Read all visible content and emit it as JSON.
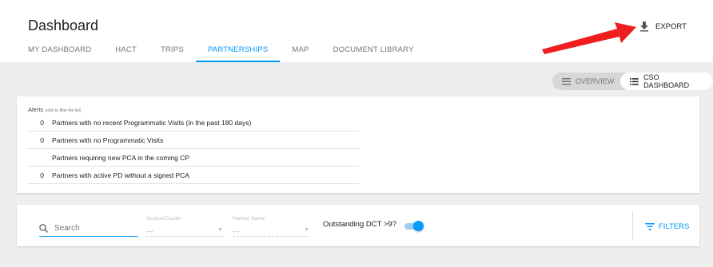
{
  "header": {
    "title": "Dashboard",
    "tabs": [
      {
        "label": "MY DASHBOARD",
        "active": false
      },
      {
        "label": "HACT",
        "active": false
      },
      {
        "label": "TRIPS",
        "active": false
      },
      {
        "label": "PARTNERSHIPS",
        "active": true
      },
      {
        "label": "MAP",
        "active": false
      },
      {
        "label": "DOCUMENT LIBRARY",
        "active": false
      }
    ],
    "export_label": "EXPORT",
    "export_icon": "download-icon"
  },
  "view_toggle": {
    "overview_label": "OVERVIEW",
    "cso_label": "CSO DASHBOARD",
    "active": "cso"
  },
  "alerts": {
    "title": "Alerts",
    "hint": "(click to filter the list)",
    "rows": [
      {
        "count": "0",
        "text": "Partners with no recent Programmatic Visits (in the past 180 days)"
      },
      {
        "count": "0",
        "text": "Partners with no Programmatic Visits"
      },
      {
        "count": "",
        "text": "Partners requiring new PCA in the coming CP"
      },
      {
        "count": "0",
        "text": "Partners with active PD without a signed PCA"
      }
    ]
  },
  "filters": {
    "search_placeholder": "Search",
    "section_label": "Section/Cluster",
    "section_value": "—",
    "partner_label": "Partner Name",
    "partner_value": "—",
    "dct_label": "Outstanding DCT >9?",
    "dct_on": true,
    "filters_label": "FILTERS"
  },
  "colors": {
    "accent": "#0099ff",
    "arrow": "#f01e1e"
  }
}
